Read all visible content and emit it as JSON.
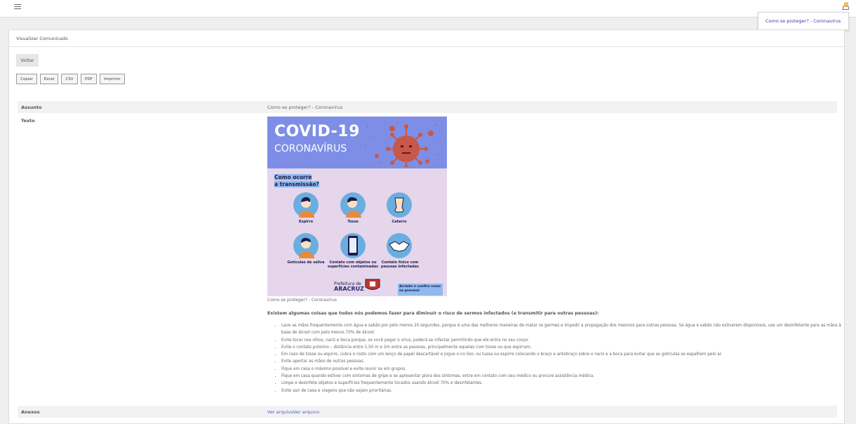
{
  "topbar": {
    "menu_icon": "hamburger-icon",
    "bell_icon": "bell-icon",
    "notification_count": "1"
  },
  "notifications": {
    "item": "Como se proteger? - Coronavirus"
  },
  "panel": {
    "title": "Visualizar Comunicado"
  },
  "toolbar": {
    "back_label": "Voltar",
    "export_buttons": [
      "Copiar",
      "Excel",
      "CSV",
      "PDF",
      "Imprimir"
    ]
  },
  "details": {
    "assunto_label": "Assunto",
    "assunto_value": "Como se proteger? - Coronavirus",
    "texto_label": "Texto",
    "anexos_label": "Anexos",
    "attachments": [
      "Ver arquivo",
      "Ver arquivo"
    ]
  },
  "poster": {
    "heading": "COVID-19",
    "subheading": "CORONAVÍRUS",
    "question_line1": "Como ocorre",
    "question_line2": "a transmissão?",
    "items": [
      "Espirro",
      "Tosse",
      "Catarro",
      "Gotículas de saliva",
      "Contato com objetos ou superfícies contaminadas",
      "Contato físico com pessoas infectadas"
    ],
    "prefeitura": "Prefeitura de",
    "city": "ARACRUZ",
    "cta": "Arraste e confira como se prevenir",
    "colors": {
      "top": "#7e8ee6",
      "body": "#e5d6ec",
      "icon_bg": "#6aaee0",
      "virus": "#c7584a"
    }
  },
  "content": {
    "caption": "Como se proteger? - Coronavirus",
    "intro": "Existem algumas coisas que todos nós podemos fazer para diminuir o risco de sermos infectados (e transmitir para outras pessoas):",
    "tips": [
      "Lave as mãos frequentemente com água e sabão por pelo menos 20 segundos, porque é uma das melhores maneiras de matar os germes e impedir a propagação dos mesmos para outras pessoas. Se água e sabão não estiverem disponíveis, use um desinfetante para as mãos à base de álcool com pelo menos 70% de álcool.",
      "Evite tocar nos olhos, nariz e boca porque, se você pegar o vírus, poderá se infectar permitindo que ele entre no seu corpo.",
      "Evite o contato próximo – distância entre 1,50 m e 2m entre as pessoas, principalmente aquelas com tosse ou que espirram.",
      "Em caso de tosse ou espirro, cubra o rosto com um lenço de papel descartável e jogue o no lixo, ou tussa ou espirre colocando o braço e antebraço sobre o nariz e a boca para evitar que as gotículas se espalhem pelo ar.",
      "Evite apertar as mãos de outras pessoas.",
      "Fique em casa o máximo possível e evite reunir se em grupos.",
      "Fique em casa quando estiver com sintomas de gripe e se apresentar piora dos sintomas, entre em contato com seu médico ou procure assistência médica.",
      "Limpe e desinfete objetos e superfícies frequentemente tocados usando álcool 70% e desinfetantes.",
      "Evite sair de casa e viagens que não sejam prioritárias."
    ]
  }
}
